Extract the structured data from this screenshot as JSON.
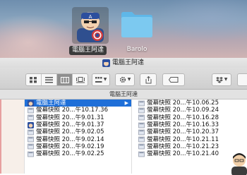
{
  "desktop": {
    "icons": [
      {
        "label": "電腦王阿達",
        "selected": true
      },
      {
        "label": "Barolo",
        "selected": false
      }
    ]
  },
  "window": {
    "title": "電腦王阿達",
    "path_title": "電腦王阿達",
    "toolbar": {
      "view_buttons": [
        "icon-view",
        "list-view",
        "column-view",
        "cover-flow-view"
      ],
      "active_view": "column-view",
      "group_label": "arrange-icon",
      "action_label": "gear-icon",
      "share_label": "share-icon",
      "tag_label": "tag-icon",
      "dropbox_label": "dropbox-icon"
    },
    "column1": [
      {
        "name": "電腦王阿達",
        "selected": true,
        "icon": "avatar-icon"
      },
      {
        "name": "螢幕快照 20...午10.17.36",
        "icon": "image-icon"
      },
      {
        "name": "螢幕快照 20...午9.01.31",
        "icon": "image-icon"
      },
      {
        "name": "螢幕快照 20...午9.01.37",
        "icon": "avatar-icon"
      },
      {
        "name": "螢幕快照 20...午9.02.05",
        "icon": "image-icon"
      },
      {
        "name": "螢幕快照 20...午9.02.14",
        "icon": "image-icon"
      },
      {
        "name": "螢幕快照 20...午9.02.19",
        "icon": "image-icon"
      },
      {
        "name": "螢幕快照 20...午9.02.25",
        "icon": "image-icon"
      }
    ],
    "column2": [
      {
        "name": "螢幕快照 20...午10.06.25"
      },
      {
        "name": "螢幕快照 20...午10.09.24"
      },
      {
        "name": "螢幕快照 20...午10.16.28"
      },
      {
        "name": "螢幕快照 20...午10.16.33"
      },
      {
        "name": "螢幕快照 20...午10.20.37"
      },
      {
        "name": "螢幕快照 20...午10.21.11"
      },
      {
        "name": "螢幕快照 20...午10.21.23"
      },
      {
        "name": "螢幕快照 20...午10.21.40"
      }
    ]
  },
  "colors": {
    "selection": "#1f6fd8",
    "folder": "#6cc1ec",
    "sidebar_accent": "#e7a0a0"
  }
}
